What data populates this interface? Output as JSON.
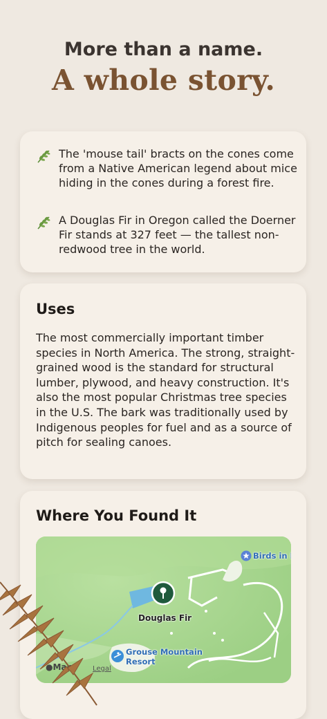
{
  "header": {
    "line1": "More than a name.",
    "line2": "A whole story."
  },
  "facts": [
    {
      "icon": "leaf-icon",
      "text": "The 'mouse tail' bracts on the cones come from a Native American legend about mice hiding in the cones during a forest fire."
    },
    {
      "icon": "leaf-icon",
      "text": "A Douglas Fir in Oregon called the Doerner Fir stands at 327 feet — the tallest non-redwood tree in the world."
    }
  ],
  "uses": {
    "title": "Uses",
    "body": "The most commercially important timber species in North America. The strong, straight-grained wood is the standard for structural lumber, plywood, and heavy construction. It's also the most popular Christmas tree species in the U.S. The bark was traditionally used by Indigenous peoples for fuel and as a source of pitch for sealing canoes."
  },
  "where": {
    "title": "Where You Found It",
    "map": {
      "pin_label": "Douglas Fir",
      "poi_1": "Birds in M",
      "poi_2_line1": "Grouse Mountain",
      "poi_2_line2": "Resort",
      "brand": "Maps",
      "legal": "Legal"
    }
  },
  "colors": {
    "background": "#efe9e1",
    "card": "#f6f0e8",
    "headline_accent": "#7a5332",
    "leaf": "#5e8f3a",
    "pin": "#1f5a3c",
    "map_green": "#a8d690"
  }
}
